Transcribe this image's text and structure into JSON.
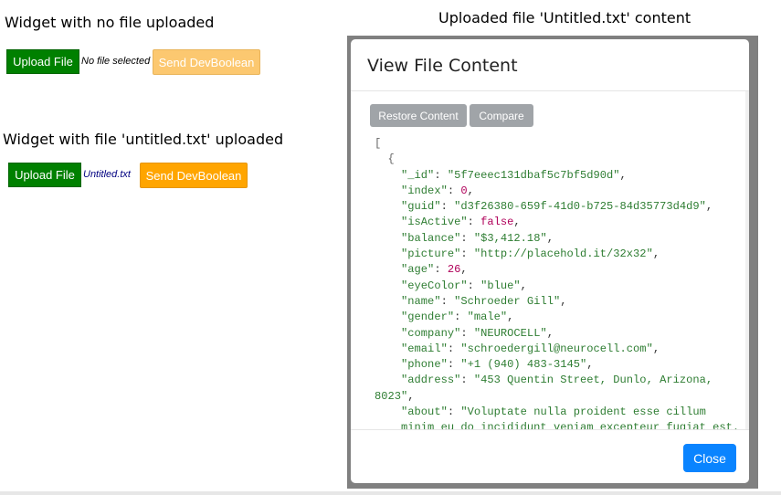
{
  "left_panel": {
    "caption_no_file": "Widget with no file uploaded",
    "caption_with_file": "Widget with file 'untitled.txt' uploaded",
    "widget_no_file": {
      "upload_label": "Upload File",
      "file_status": "No file selected",
      "send_label": "Send DevBoolean",
      "send_enabled": false
    },
    "widget_with_file": {
      "upload_label": "Upload File",
      "file_status": "Untitled.txt",
      "send_label": "Send DevBoolean",
      "send_enabled": true
    }
  },
  "right_caption": "Uploaded file 'Untitled.txt' content",
  "modal": {
    "title": "View File Content",
    "restore_label": "Restore Content",
    "compare_label": "Compare",
    "close_label": "Close",
    "json_lines": [
      {
        "open": "["
      },
      {
        "open": "{"
      },
      {
        "key": "\"_id\"",
        "val": "\"5f7eeec131dbaf5c7bf5d90d\"",
        "type": "s"
      },
      {
        "key": "\"index\"",
        "val": "0",
        "type": "n"
      },
      {
        "key": "\"guid\"",
        "val": "\"d3f26380-659f-41d0-b725-84d35773d4d9\"",
        "type": "s"
      },
      {
        "key": "\"isActive\"",
        "val": "false",
        "type": "n"
      },
      {
        "key": "\"balance\"",
        "val": "\"$3,412.18\"",
        "type": "s"
      },
      {
        "key": "\"picture\"",
        "val": "\"http://placehold.it/32x32\"",
        "type": "s"
      },
      {
        "key": "\"age\"",
        "val": "26",
        "type": "n"
      },
      {
        "key": "\"eyeColor\"",
        "val": "\"blue\"",
        "type": "s"
      },
      {
        "key": "\"name\"",
        "val": "\"Schroeder Gill\"",
        "type": "s"
      },
      {
        "key": "\"gender\"",
        "val": "\"male\"",
        "type": "s"
      },
      {
        "key": "\"company\"",
        "val": "\"NEUROCELL\"",
        "type": "s"
      },
      {
        "key": "\"email\"",
        "val": "\"schroedergill@neurocell.com\"",
        "type": "s"
      },
      {
        "key": "\"phone\"",
        "val": "\"+1 (940) 483-3145\"",
        "type": "s"
      },
      {
        "key": "\"address\"",
        "val": "\"453 Quentin Street, Dunlo, Arizona,",
        "type": "s"
      },
      {
        "cont": "8023\""
      },
      {
        "key": "\"about\"",
        "val": "\"Voluptate nulla proident esse cillum",
        "type": "s"
      },
      {
        "cont": "minim eu do incididunt veniam excepteur fugiat est."
      }
    ]
  },
  "colors": {
    "upload_green": "#008000",
    "send_orange": "#ffa500",
    "send_orange_disabled": "#fcc870",
    "close_blue": "#0a84ff",
    "grey_button": "#a0a4a8"
  }
}
